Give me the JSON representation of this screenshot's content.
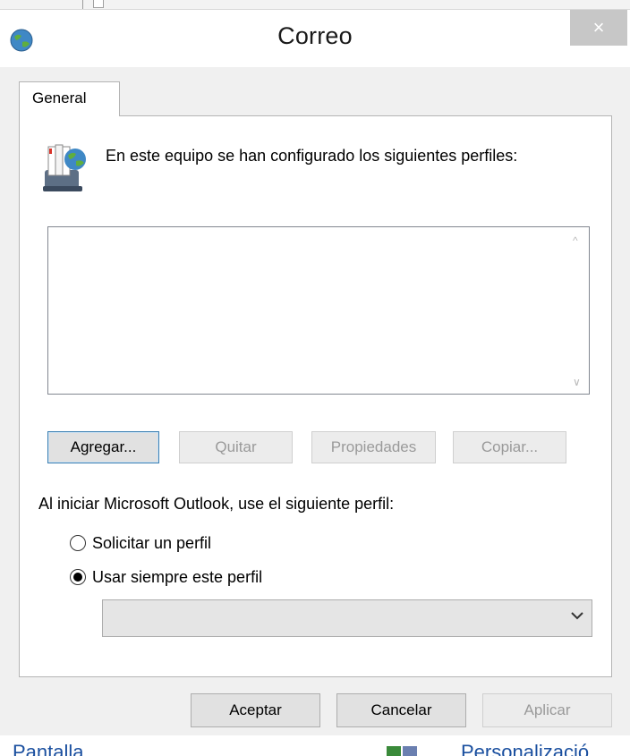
{
  "dialog": {
    "title": "Correo",
    "close_label": "×"
  },
  "tabs": [
    {
      "label": "General"
    }
  ],
  "general": {
    "info_text": "En este equipo se han configurado los siguientes perfiles:",
    "profiles": [],
    "buttons": {
      "add": "Agregar...",
      "remove": "Quitar",
      "properties": "Propiedades",
      "copy": "Copiar..."
    },
    "startup_label": "Al iniciar Microsoft Outlook, use el siguiente perfil:",
    "options": [
      {
        "label": "Solicitar un perfil",
        "selected": false
      },
      {
        "label": "Usar siempre este perfil",
        "selected": true
      }
    ],
    "profile_select_value": ""
  },
  "footer": {
    "ok": "Aceptar",
    "cancel": "Cancelar",
    "apply": "Aplicar"
  },
  "background_window": {
    "left_text": "Pantalla",
    "right_text": "Personalizació"
  },
  "colors": {
    "accent_border": "#3c7fb1",
    "disabled_text": "#9a9a9a",
    "close_button": "#c7c7c7"
  }
}
